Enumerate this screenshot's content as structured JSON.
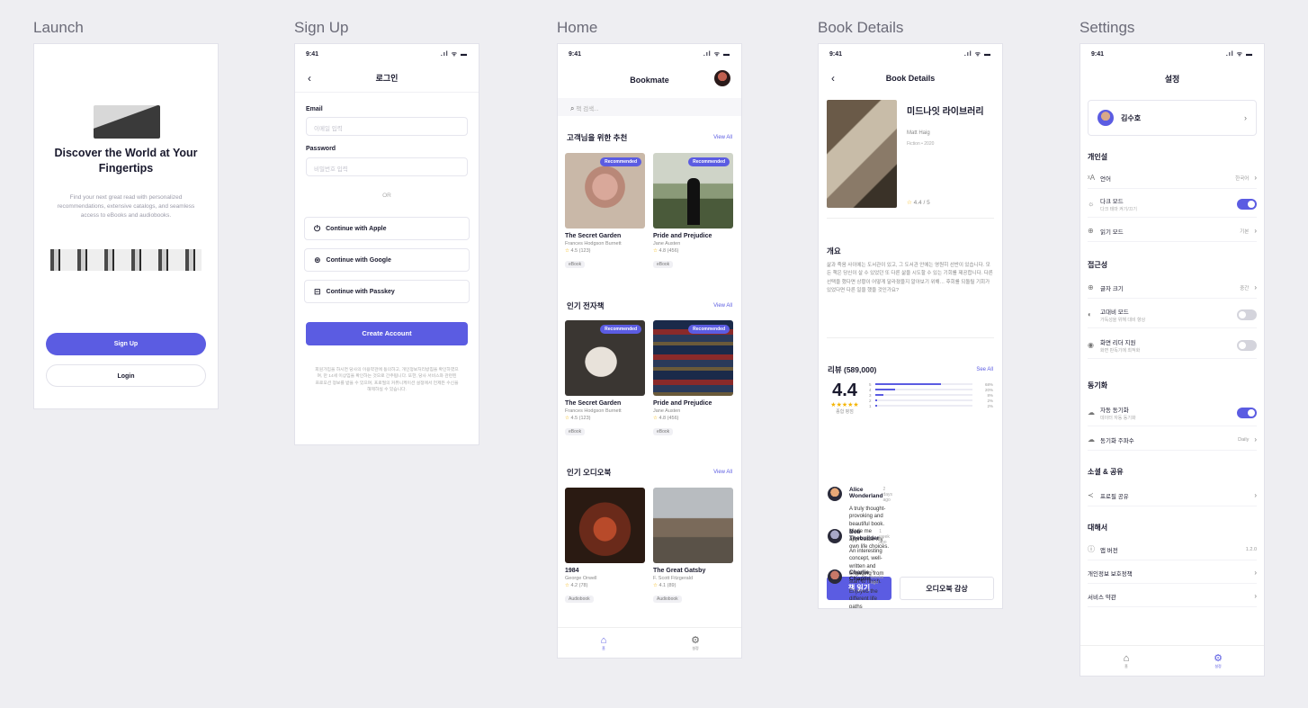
{
  "boards": {
    "launch": "Launch",
    "signup": "Sign Up",
    "home": "Home",
    "details": "Book Details",
    "settings": "Settings"
  },
  "status": {
    "time": "9:41",
    "icons": ".ıl ᯤ ▬"
  },
  "launch": {
    "headline": "Discover the World at Your Fingertips",
    "body": "Find your next great read with personalized recommendations, extensive catalogs, and seamless access to eBooks and audiobooks.",
    "signup_button": "Sign Up",
    "login_button": "Login"
  },
  "signup": {
    "title": "로그인",
    "email_label": "Email",
    "email_placeholder": "이메일 입력",
    "password_label": "Password",
    "password_placeholder": "비밀번호 입력",
    "or": "OR",
    "apple": "Continue with Apple",
    "google": "Continue with Google",
    "passkey": "Continue with Passkey",
    "create": "Create Account",
    "terms": "회원가입을 하시면 당사의 이용약관에 동의하고, 개인정보처리방침을 확인하였으며, 만 14세 이상임을 확인하는 것으로 간주됩니다. 또한, 당사 서비스와 관련된 프로모션 정보를 받을 수 있으며, 프로필의 커뮤니케이션 설정에서 언제든 수신을 해제하실 수 있습니다."
  },
  "home": {
    "title": "Bookmate",
    "search_placeholder": "책 검색...",
    "view_all": "View All",
    "recommended_badge": "Recommended",
    "sections": [
      {
        "heading": "고객님을 위한 추천",
        "books": [
          {
            "title": "The Secret Garden",
            "author": "Frances Hodgson Burnett",
            "rating": "4.5 (123)",
            "format": "eBook"
          },
          {
            "title": "Pride and Prejudice",
            "author": "Jane Austen",
            "rating": "4.8 (456)",
            "format": "eBook"
          }
        ]
      },
      {
        "heading": "인기 전자책",
        "books": [
          {
            "title": "The Secret Garden",
            "author": "Frances Hodgson Burnett",
            "rating": "4.5 (123)",
            "format": "eBook"
          },
          {
            "title": "Pride and Prejudice",
            "author": "Jane Austen",
            "rating": "4.8 (456)",
            "format": "eBook"
          }
        ]
      },
      {
        "heading": "인기 오디오북",
        "books": [
          {
            "title": "1984",
            "author": "George Orwell",
            "rating": "4.2 (78)",
            "format": "Audiobook"
          },
          {
            "title": "The Great Gatsby",
            "author": "F. Scott Fitzgerald",
            "rating": "4.1 (89)",
            "format": "Audiobook"
          }
        ]
      }
    ],
    "nav": {
      "home": "홈",
      "settings": "설정"
    }
  },
  "details": {
    "title": "Book Details",
    "book_title": "미드나잇 라이브러리",
    "author": "Matt Haig",
    "meta": "Fiction • 2020",
    "rating": "4.4 / 5",
    "overview_heading": "개요",
    "overview": "삶과 죽음 사이에는 도서관이 있고, 그 도서관 안에는 영원히 선반이 있습니다. 모든 책은 당신이 살 수 있었던 또 다른 삶을 시도할 수 있는 기회를 제공합니다. 다른 선택을 했다면 상황이 어떻게 달라졌을지 알아보기 위해… 후회를 되돌릴 기회가 있었다면 다른 일을 했을 것인가요?",
    "reviews_heading": "리뷰 (589,000)",
    "see_all": "See All",
    "avg": "4.4",
    "stars": "★★★★★",
    "avg_label": "종합 평점",
    "distribution": [
      {
        "star": "5",
        "pct": 0.68,
        "label": "68%"
      },
      {
        "star": "4",
        "pct": 0.2,
        "label": "20%"
      },
      {
        "star": "3",
        "pct": 0.08,
        "label": "8%"
      },
      {
        "star": "2",
        "pct": 0.02,
        "label": "2%"
      },
      {
        "star": "1",
        "pct": 0.02,
        "label": "2%"
      }
    ],
    "reviews": [
      {
        "name": "Alice Wonderland",
        "date": "2 days ago",
        "text": "A truly thought-provoking and beautiful book. Made me appreciate my own life choices."
      },
      {
        "name": "Bob Thebuilder",
        "date": "1 week ago",
        "text": "An interesting concept, well-written and engaging from start to finish."
      },
      {
        "name": "Charlie Chaplin",
        "date": "3 weeks ago",
        "text": "Enjoyed the different life paths explored, a unique read."
      }
    ],
    "read_button": "책 읽기",
    "audio_button": "오디오북 감상"
  },
  "settings": {
    "title": "설정",
    "user": "김수호",
    "sections": {
      "personal": "개인설",
      "access": "접근성",
      "sync": "동기화",
      "social": "소셜 & 공유",
      "about": "대해서"
    },
    "rows": {
      "language": "언어",
      "language_val": "한국어",
      "dark": "다크 모드",
      "dark_sub": "다크 테마 켜기/끄기",
      "reading": "읽기 모드",
      "reading_val": "기본",
      "font": "글자 크기",
      "font_val": "중간",
      "contrast": "고대비 모드",
      "contrast_sub": "가독성을 위해 대비 향상",
      "reader": "화면 리더 지원",
      "reader_sub": "화면 판독기에 최적화",
      "autosync": "자동 동기화",
      "autosync_sub": "데이터 자동 동기화",
      "freq": "동기화 주파수",
      "freq_val": "Daily",
      "share": "프로필 공유",
      "version": "앱 버전",
      "version_val": "1.2.0",
      "privacy": "개인정보 보호정책",
      "terms": "서비스 약관"
    },
    "nav": {
      "home": "홈",
      "settings": "설정"
    }
  }
}
